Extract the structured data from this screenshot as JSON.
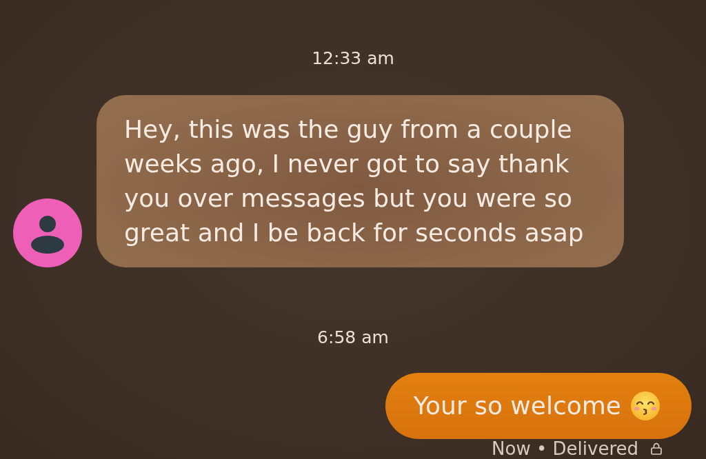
{
  "messages": [
    {
      "kind": "timestamp",
      "text": "12:33 am"
    },
    {
      "kind": "incoming",
      "text": "Hey, this was the guy from a couple weeks ago, I never got to say thank you over messages but you were so great and I be back for seconds asap"
    },
    {
      "kind": "timestamp",
      "text": "6:58 am"
    },
    {
      "kind": "outgoing",
      "text": "Your so welcome",
      "status": "Now • Delivered"
    }
  ]
}
